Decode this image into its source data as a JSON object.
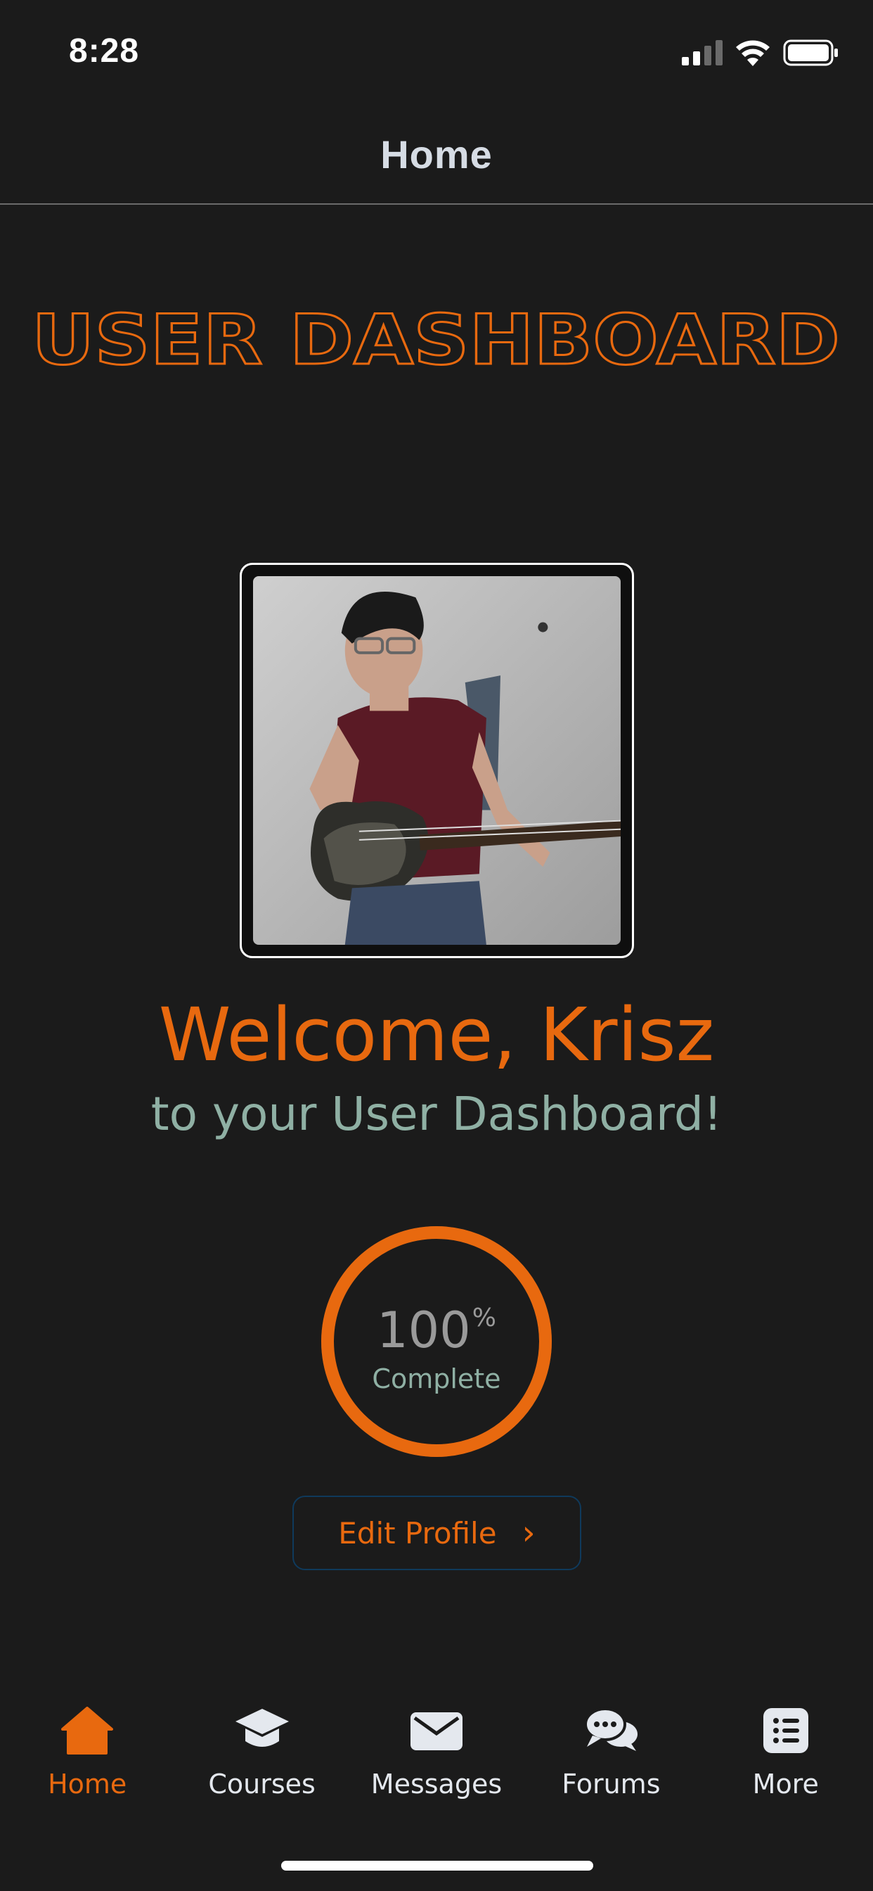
{
  "status_bar": {
    "time": "8:28"
  },
  "nav": {
    "title": "Home"
  },
  "dashboard": {
    "logo_text": "USER DASHBOARD",
    "welcome": "Welcome, Krisz",
    "subtitle": "to your User Dashboard!"
  },
  "progress": {
    "value": "100",
    "unit": "%",
    "caption": "Complete",
    "fraction": 1.0
  },
  "edit_profile": {
    "label": "Edit Profile",
    "chevron": "›"
  },
  "tabs": [
    {
      "label": "Home",
      "icon": "home-icon",
      "active": true
    },
    {
      "label": "Courses",
      "icon": "graduation-cap-icon",
      "active": false
    },
    {
      "label": "Messages",
      "icon": "envelope-icon",
      "active": false
    },
    {
      "label": "Forums",
      "icon": "chat-bubbles-icon",
      "active": false
    },
    {
      "label": "More",
      "icon": "list-icon",
      "active": false
    }
  ],
  "colors": {
    "accent": "#e8690f",
    "muted_teal": "#8fb0a4",
    "background": "#1b1b1b"
  }
}
